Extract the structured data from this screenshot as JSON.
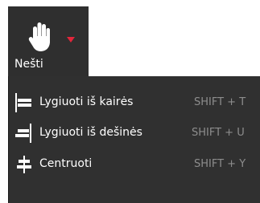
{
  "tool": {
    "label": "Nešti",
    "icon": "hand-icon",
    "accent_color": "#e3263b"
  },
  "menu": {
    "items": [
      {
        "label": "Lygiuoti iš kairės",
        "shortcut": "SHIFT + T",
        "icon": "align-left-icon"
      },
      {
        "label": "Lygiuoti iš dešinės",
        "shortcut": "SHIFT + U",
        "icon": "align-right-icon"
      },
      {
        "label": "Centruoti",
        "shortcut": "SHIFT + Y",
        "icon": "align-center-icon"
      }
    ]
  }
}
